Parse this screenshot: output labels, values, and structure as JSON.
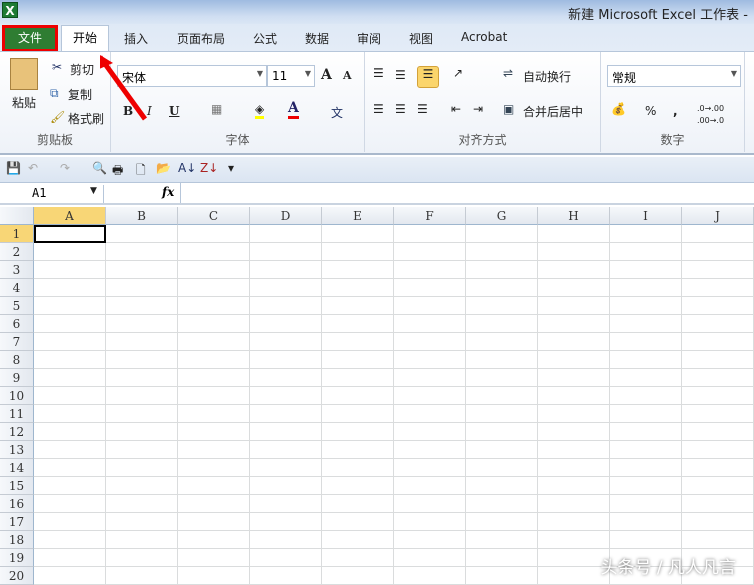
{
  "window": {
    "title": "新建 Microsoft Excel 工作表 -",
    "app_icon": "X"
  },
  "tabs": [
    "文件",
    "开始",
    "插入",
    "页面布局",
    "公式",
    "数据",
    "审阅",
    "视图",
    "Acrobat"
  ],
  "clipboard": {
    "paste": "粘贴",
    "cut": "剪切",
    "copy": "复制",
    "format_painter": "格式刷",
    "label": "剪贴板"
  },
  "font": {
    "name": "宋体",
    "size": "11",
    "bold": "B",
    "italic": "I",
    "underline": "U",
    "grow": "A",
    "shrink": "A",
    "font_color": "A",
    "phonetic": "文",
    "label": "字体"
  },
  "alignment": {
    "wrap": "自动换行",
    "merge": "合并后居中",
    "label": "对齐方式"
  },
  "number": {
    "format": "常规",
    "percent": "%",
    "comma": ",",
    "inc_decimal": ".0→.00",
    "dec_decimal": ".00→.0",
    "label": "数字"
  },
  "formula_bar": {
    "name_box": "A1",
    "fx": "fx",
    "value": ""
  },
  "columns": [
    "A",
    "B",
    "C",
    "D",
    "E",
    "F",
    "G",
    "H",
    "I",
    "J"
  ],
  "rows": [
    "1",
    "2",
    "3",
    "4",
    "5",
    "6",
    "7",
    "8",
    "9",
    "10",
    "11",
    "12",
    "13",
    "14",
    "15",
    "16",
    "17",
    "18",
    "19",
    "20"
  ],
  "selected_cell": "A1",
  "watermark": "头条号 / 凡人凡言",
  "colors": {
    "file_tab": "#2f7d32",
    "highlight": "#e00000",
    "selection": "#f8d676"
  }
}
